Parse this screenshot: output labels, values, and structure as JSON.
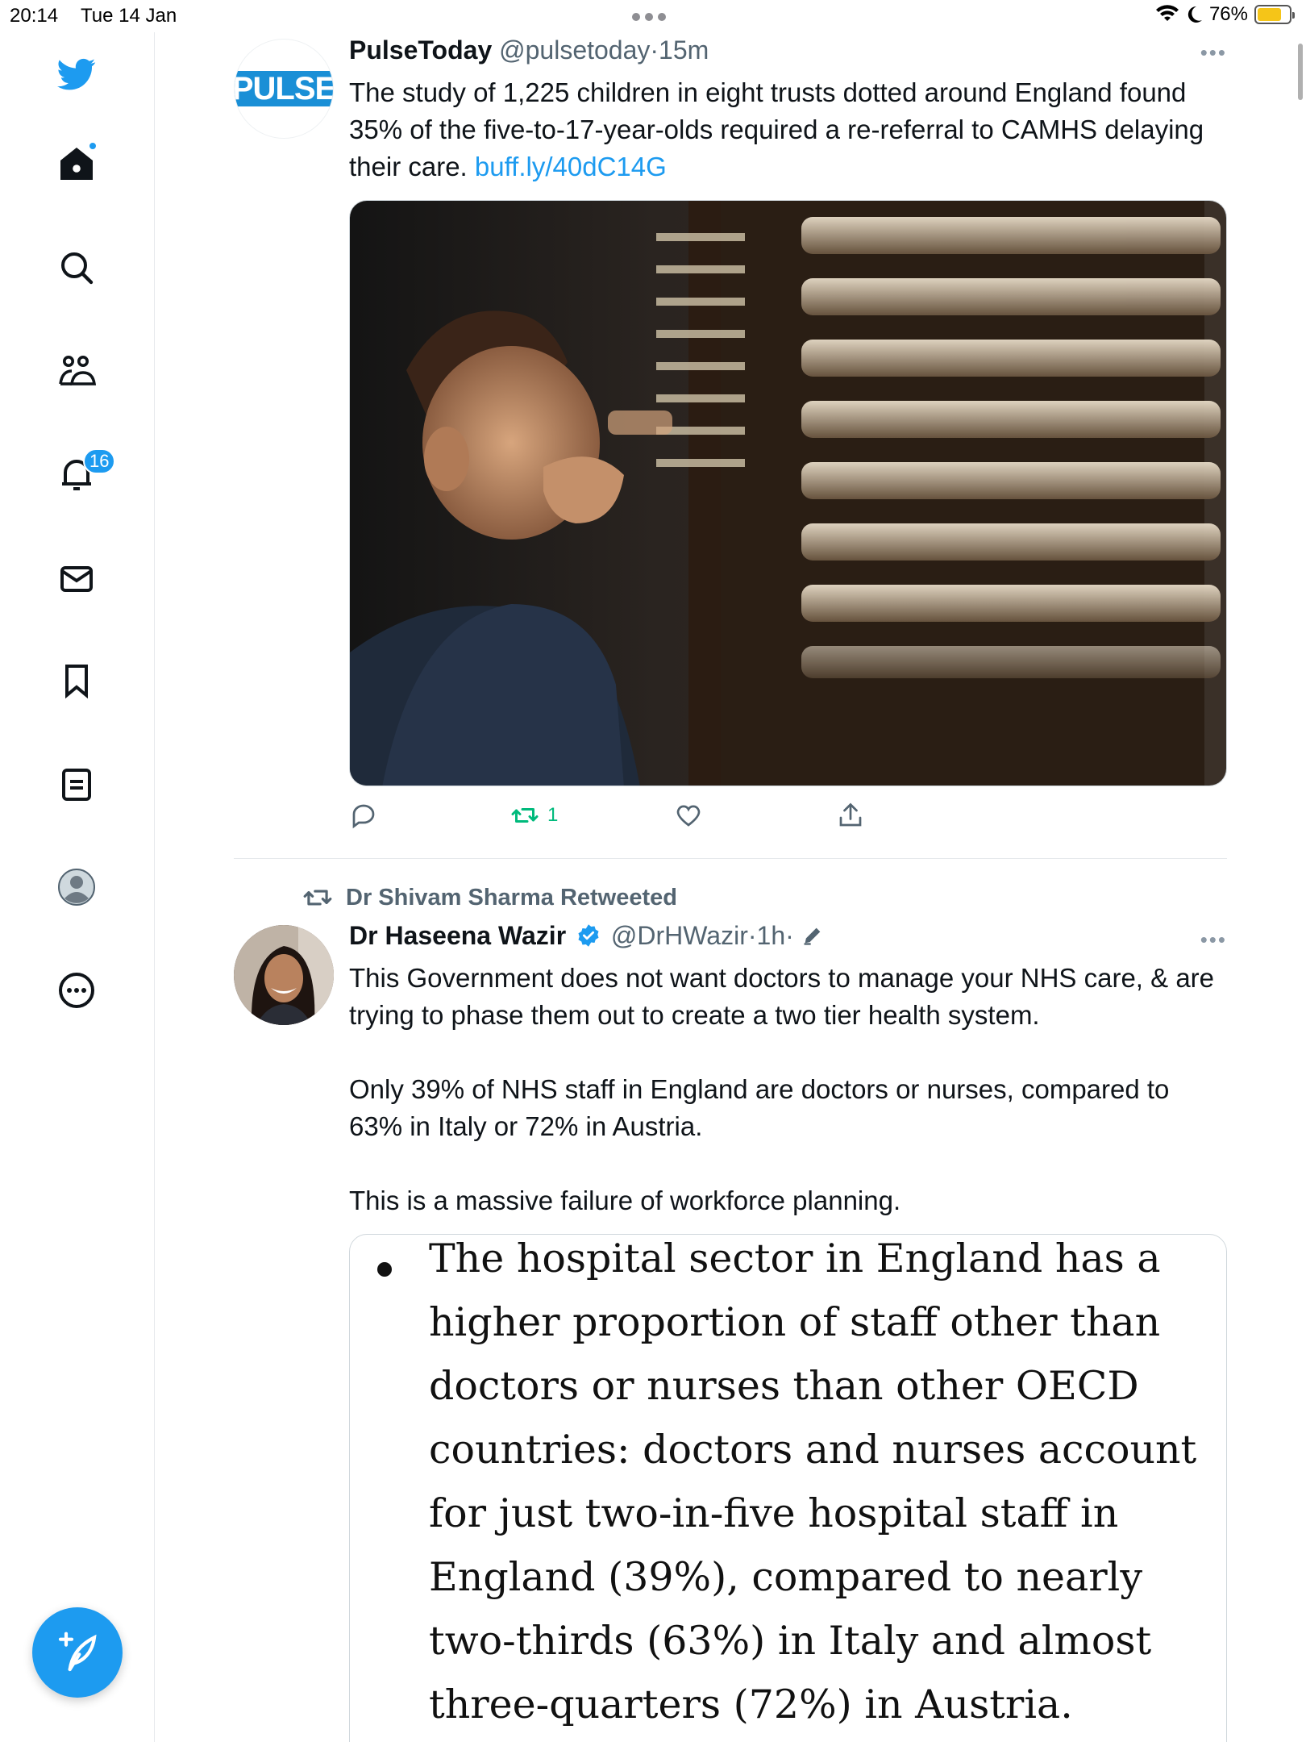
{
  "status_bar": {
    "time": "20:14",
    "date": "Tue 14 Jan",
    "battery": "76%",
    "battery_level": 0.76
  },
  "sidebar": {
    "items": [
      {
        "icon": "twitter-logo-icon"
      },
      {
        "icon": "home-icon"
      },
      {
        "icon": "search-icon"
      },
      {
        "icon": "communities-icon"
      },
      {
        "icon": "notifications-icon",
        "badge": "16"
      },
      {
        "icon": "messages-icon"
      },
      {
        "icon": "bookmarks-icon"
      },
      {
        "icon": "lists-icon"
      },
      {
        "icon": "profile-icon"
      },
      {
        "icon": "more-icon"
      }
    ],
    "compose_icon": "compose-tweet-icon"
  },
  "tweets": [
    {
      "name": "PulseToday",
      "handle": "@pulsetoday",
      "time": "15m",
      "avatar_text": "PULSE",
      "text": "The study of 1,225 children in eight trusts dotted around England found 35% of the five-to-17-year-olds required a re-referral to CAMHS delaying their care.",
      "link": "buff.ly/40dC14G",
      "retweet_count": "1"
    },
    {
      "retweeted_by": "Dr Shivam Sharma Retweeted",
      "name": "Dr Haseena Wazir",
      "handle": "@DrHWazir",
      "time": "1h",
      "paragraphs": [
        "This Government does not want doctors to manage your NHS care, & are trying to phase them out to create a two tier health system.",
        "Only 39% of NHS staff in England are doctors or nurses, compared to 63% in Italy or 72% in Austria.",
        "This is a massive failure of workforce planning."
      ],
      "card_text": "The hospital sector in England has a higher proportion of staff other than doctors or nurses than other OECD countries: doctors and nurses account for just two-in-five hospital staff in England (39%), compared to nearly two-thirds (63%) in Italy and almost three-quarters (72%) in Austria."
    }
  ],
  "colors": {
    "accent": "#1d9bf0",
    "retweet_green": "#00ba7c",
    "muted": "#536471",
    "pulse_blue": "#1a8fd6"
  }
}
